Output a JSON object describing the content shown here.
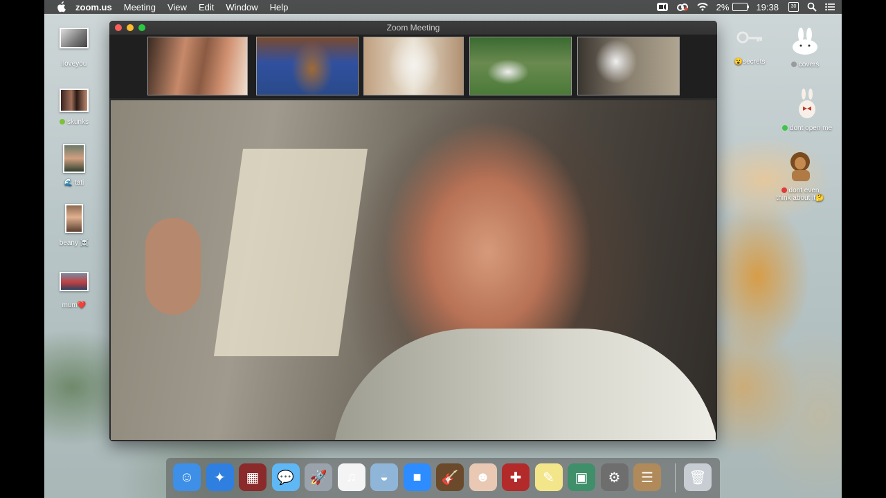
{
  "menubar": {
    "app_name": "zoom.us",
    "menus": [
      "Meeting",
      "View",
      "Edit",
      "Window",
      "Help"
    ],
    "battery": "2%",
    "time": "19:38",
    "calendar_day": "30"
  },
  "desktop_left": [
    {
      "label": "iloveyou",
      "icon": "cat-photo-thumbnail"
    },
    {
      "label": "skunks",
      "icon": "friends-photo-thumbnail",
      "tag_color": "#7dc13a"
    },
    {
      "label": "tati",
      "icon": "selfie-photo-thumbnail",
      "emoji": "🌊"
    },
    {
      "label": "beany",
      "icon": "portrait-photo-thumbnail",
      "emoji": "☠️"
    },
    {
      "label": "mum",
      "icon": "landscape-photo-thumbnail",
      "emoji": "❤️"
    }
  ],
  "desktop_right": [
    {
      "label": "secrets",
      "icon": "keys-icon",
      "emoji": "😮"
    },
    {
      "label": "covers",
      "icon": "bunny-icon",
      "tag_color": "#9a9a9a"
    },
    {
      "label": "dont open me",
      "icon": "bunny-with-bow-icon",
      "tag_color": "#3fc54a"
    },
    {
      "label_line1": "dont even",
      "label_line2": "think about it",
      "icon": "lion-icon",
      "tag_color": "#e23a3a",
      "emoji": "🤔"
    }
  ],
  "zoom_window": {
    "title": "Zoom Meeting",
    "participants": [
      {
        "name": "participant-man"
      },
      {
        "name": "participant-dachshund"
      },
      {
        "name": "participant-white-dog"
      },
      {
        "name": "participant-dogs-yard"
      },
      {
        "name": "participant-husky"
      }
    ]
  },
  "dock": [
    {
      "name": "finder-icon",
      "glyph": "☺",
      "color": "#3d8fe8"
    },
    {
      "name": "safari-icon",
      "glyph": "✦",
      "color": "#2f7fe0"
    },
    {
      "name": "photo-booth-icon",
      "glyph": "▦",
      "color": "#8b2a2a"
    },
    {
      "name": "messages-icon",
      "glyph": "💬",
      "color": "#5fb8f5"
    },
    {
      "name": "launchpad-icon",
      "glyph": "🚀",
      "color": "#9aa3ab"
    },
    {
      "name": "itunes-icon",
      "glyph": "♫",
      "color": "#f4f4f4"
    },
    {
      "name": "seal-app-icon",
      "glyph": "◒",
      "color": "#8fb6d8"
    },
    {
      "name": "zoom-icon",
      "glyph": "■",
      "color": "#2d8cff"
    },
    {
      "name": "garageband-icon",
      "glyph": "🎸",
      "color": "#6a4a2a"
    },
    {
      "name": "face-app-icon",
      "glyph": "☻",
      "color": "#e9c9b3"
    },
    {
      "name": "photo-app-icon",
      "glyph": "✚",
      "color": "#b32a2a"
    },
    {
      "name": "stickies-icon",
      "glyph": "✎",
      "color": "#f3e58a"
    },
    {
      "name": "preview-icon",
      "glyph": "▣",
      "color": "#3e8f6a"
    },
    {
      "name": "system-preferences-icon",
      "glyph": "⚙",
      "color": "#6e6e6e"
    },
    {
      "name": "contacts-icon",
      "glyph": "☰",
      "color": "#b08a5a"
    },
    {
      "name": "trash-icon",
      "glyph": "🗑",
      "color": "#c7cdd2"
    }
  ]
}
